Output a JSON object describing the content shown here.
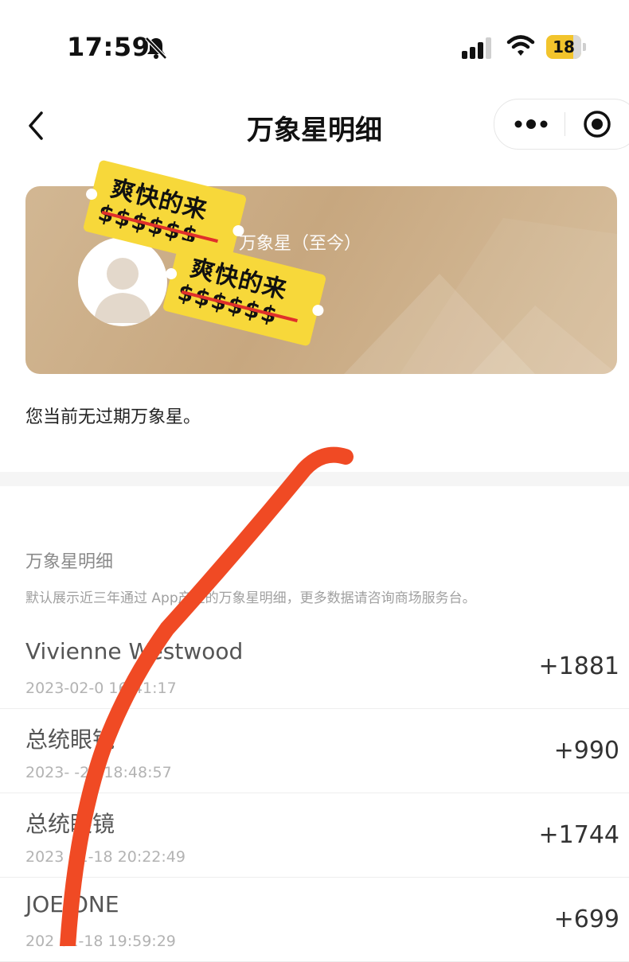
{
  "status_bar": {
    "time": "17:59",
    "battery_level": "18",
    "icons": [
      "bell-off-icon",
      "cellular-signal-icon",
      "wifi-icon",
      "battery-icon"
    ]
  },
  "nav": {
    "title": "万象星明细",
    "back_icon": "chevron-left-icon",
    "more_icon": "more-dots-icon",
    "close_icon": "record-circle-icon"
  },
  "card": {
    "label": "万象星（至今）",
    "avatar_icon": "user-avatar-icon"
  },
  "stickers": [
    {
      "title": "爽快的来",
      "money": "$$$$$$"
    },
    {
      "title": "爽快的来",
      "money": "$$$$$$"
    }
  ],
  "notice": "您当前无过期万象星。",
  "detail_section": {
    "title": "万象星明细",
    "description": "默认展示近三年通过    App产生的万象星明细，更多数据请咨询商场服务台。"
  },
  "records": [
    {
      "name": "Vivienne Westwood",
      "time": "2023-02-0  16:41:17",
      "points": "+1881"
    },
    {
      "name": "总统眼镜",
      "time": "2023-  -25 18:48:57",
      "points": "+990"
    },
    {
      "name": "总统眼镜",
      "time": "2023 01-18 20:22:49",
      "points": "+1744"
    },
    {
      "name": "JOE ONE",
      "time": "202  01-18 19:59:29",
      "points": "+699"
    }
  ],
  "colors": {
    "card_gradient_start": "#d2b793",
    "card_gradient_end": "#d8c09f",
    "sticker_yellow": "#f7d83a",
    "scribble_red": "#f04a24",
    "battery_yellow": "#f2c42c"
  }
}
